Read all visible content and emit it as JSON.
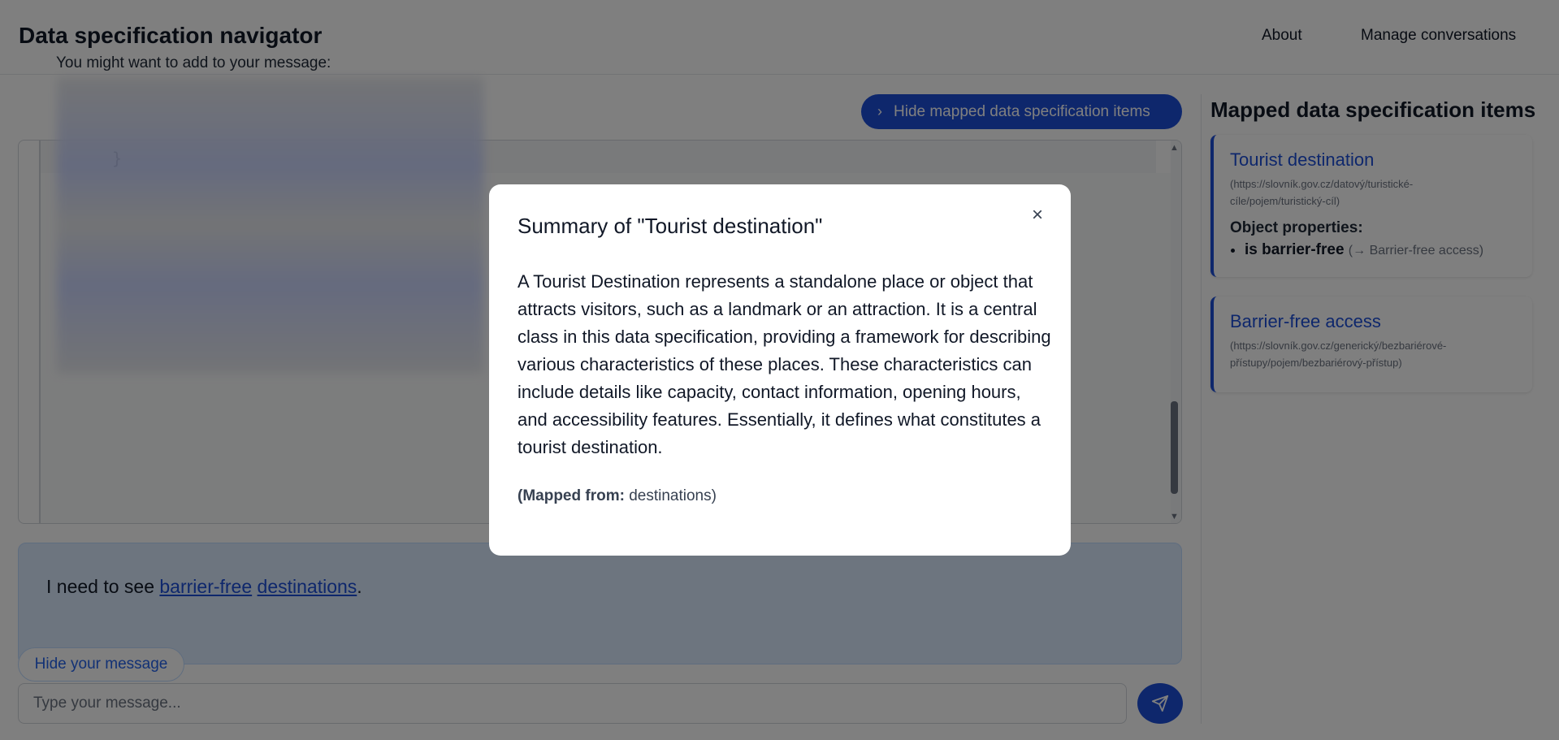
{
  "header": {
    "title": "Data specification navigator",
    "nav": {
      "about": "About",
      "manage": "Manage conversations"
    }
  },
  "main": {
    "hide_mapped_label": "Hide mapped data specification items",
    "code_brace": "}",
    "suggestion_label": "You might want to add to your message:",
    "message": {
      "prefix": "I need to see ",
      "link1": "barrier-free",
      "space": " ",
      "link2": "destinations",
      "suffix": "."
    },
    "hide_message_label": "Hide your message",
    "input_placeholder": "Type your message..."
  },
  "sidebar": {
    "title": "Mapped data specification items",
    "cards": [
      {
        "title": "Tourist destination",
        "url": "(https://slovník.gov.cz/datový/turistické-cíle/pojem/turistický-cíl)",
        "subheading": "Object properties:",
        "property": "is barrier-free",
        "property_target": "(→ Barrier-free access)"
      },
      {
        "title": "Barrier-free access",
        "url": "(https://slovník.gov.cz/generický/bezbariérové-přístupy/pojem/bezbariérový-přístup)"
      }
    ]
  },
  "modal": {
    "title": "Summary of \"Tourist destination\"",
    "close": "×",
    "body": "A Tourist Destination represents a standalone place or object that attracts visitors, such as a landmark or an attraction. It is a central class in this data specification, providing a framework for describing various characteristics of these places. These characteristics can include details like capacity, contact information, opening hours, and accessibility features. Essentially, it defines what constitutes a tourist destination.",
    "mapped_label": "(Mapped from:",
    "mapped_value": " destinations)"
  },
  "colors": {
    "accent": "#1d4ed8",
    "overlay": "rgba(0,0,0,0.5)"
  },
  "icons": {
    "hide_mapped": "chevron-right-icon",
    "close": "close-icon",
    "send": "send-icon"
  }
}
